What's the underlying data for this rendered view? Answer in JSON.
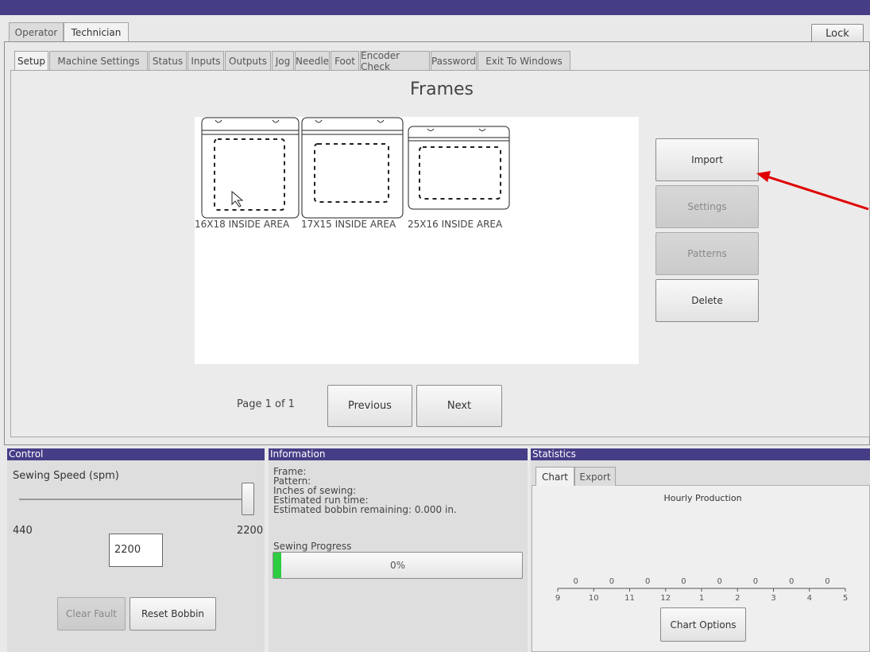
{
  "top_tabs": [
    "Operator",
    "Technician"
  ],
  "lock_label": "Lock",
  "sub_tabs": [
    "Setup",
    "Machine Settings",
    "Status",
    "Inputs",
    "Outputs",
    "Jog",
    "Needle",
    "Foot",
    "Encoder Check",
    "Password",
    "Exit To Windows"
  ],
  "frames_title": "Frames",
  "frames": [
    {
      "label": "16X18 INSIDE AREA"
    },
    {
      "label": "17X15 INSIDE AREA"
    },
    {
      "label": "25X16 INSIDE AREA"
    }
  ],
  "side_buttons": {
    "import": "Import",
    "settings": "Settings",
    "patterns": "Patterns",
    "delete": "Delete"
  },
  "pagination": {
    "page_text": "Page 1 of 1",
    "previous": "Previous",
    "next": "Next"
  },
  "control": {
    "title": "Control",
    "speed_label": "Sewing Speed (spm)",
    "min": "440",
    "max": "2200",
    "value": "2200",
    "slider_level": 1.0,
    "clear_fault": "Clear Fault",
    "reset_bobbin": "Reset Bobbin"
  },
  "information": {
    "title": "Information",
    "lines": [
      "Frame:",
      "Pattern:",
      "Inches of sewing:",
      "Estimated run time:",
      "Estimated bobbin remaining: 0.000 in."
    ],
    "progress_label": "Sewing Progress",
    "progress_text": "0%"
  },
  "statistics": {
    "title": "Statistics",
    "tabs": [
      "Chart",
      "Export"
    ],
    "chart_options": "Chart Options"
  },
  "chart_data": {
    "type": "bar",
    "title": "Hourly Production",
    "categories": [
      "9",
      "10",
      "11",
      "12",
      "1",
      "2",
      "3",
      "4",
      "5"
    ],
    "values": [
      0,
      0,
      0,
      0,
      0,
      0,
      0,
      0
    ],
    "value_labels": [
      "0",
      "0",
      "0",
      "0",
      "0",
      "0",
      "0",
      "0"
    ],
    "xlabel": "",
    "ylabel": ""
  },
  "colors": {
    "header": "#463d87",
    "progress_fill": "#2ecc40",
    "annotation_arrow": "#e00000"
  },
  "icons": [
    "mouse-cursor-icon",
    "annotation-arrow"
  ]
}
